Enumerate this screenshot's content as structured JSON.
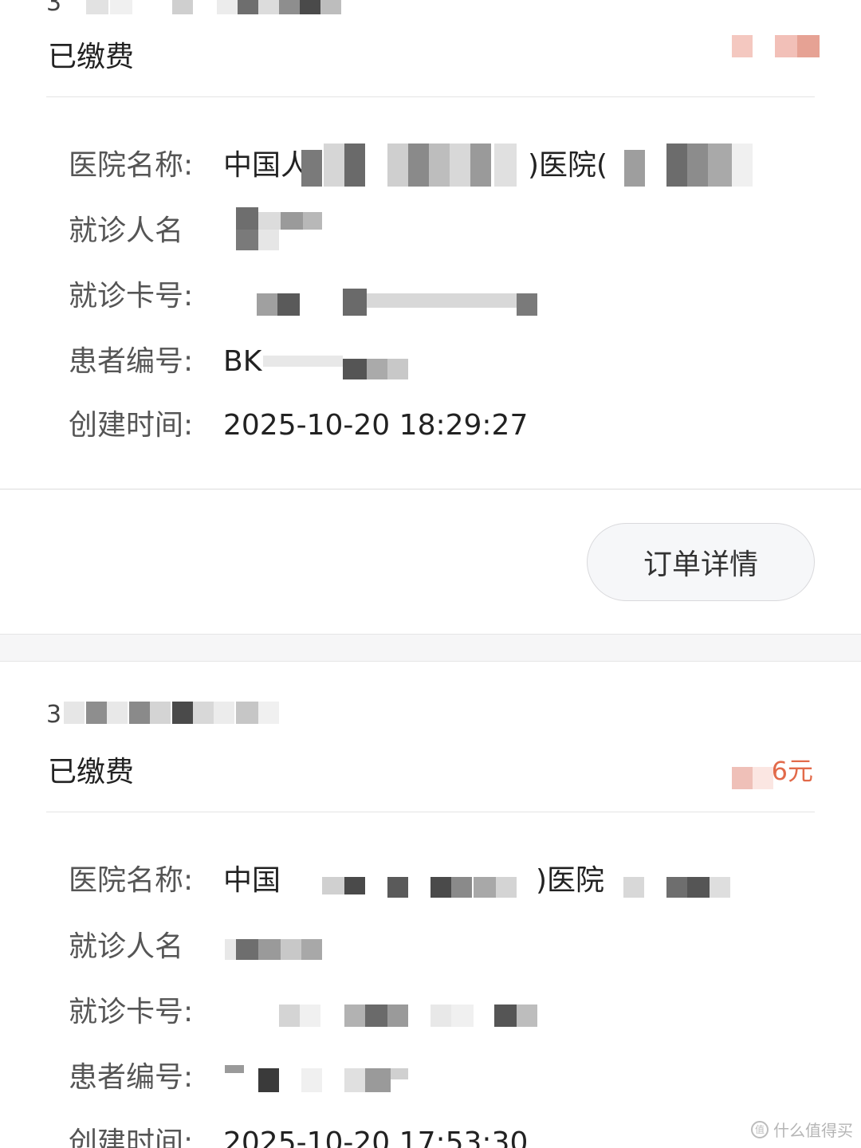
{
  "orders": [
    {
      "order_no": "3",
      "status": "已缴费",
      "amount": "",
      "fields": [
        {
          "label": "医院名称:",
          "value": "中国人"
        },
        {
          "label": "就诊人名",
          "value": ""
        },
        {
          "label": "就诊卡号:",
          "value": ""
        },
        {
          "label": "患者编号:",
          "value": "BK"
        },
        {
          "label": "创建时间:",
          "value": "2025-10-20 18:29:27"
        }
      ],
      "detail_button": "订单详情"
    },
    {
      "order_no": "3",
      "status": "已缴费",
      "amount": "6元",
      "fields": [
        {
          "label": "医院名称:",
          "value": "中国"
        },
        {
          "label": "就诊人名",
          "value": ""
        },
        {
          "label": "就诊卡号:",
          "value": ""
        },
        {
          "label": "患者编号:",
          "value": ""
        },
        {
          "label": "创建时间:",
          "value": "2025-10-20 17:53:30"
        }
      ]
    }
  ],
  "watermark": "什么值得买",
  "colors": {
    "amount": "#e26a4a",
    "redaction_dark": "#555555",
    "redaction_light": "#cfcfcf"
  }
}
